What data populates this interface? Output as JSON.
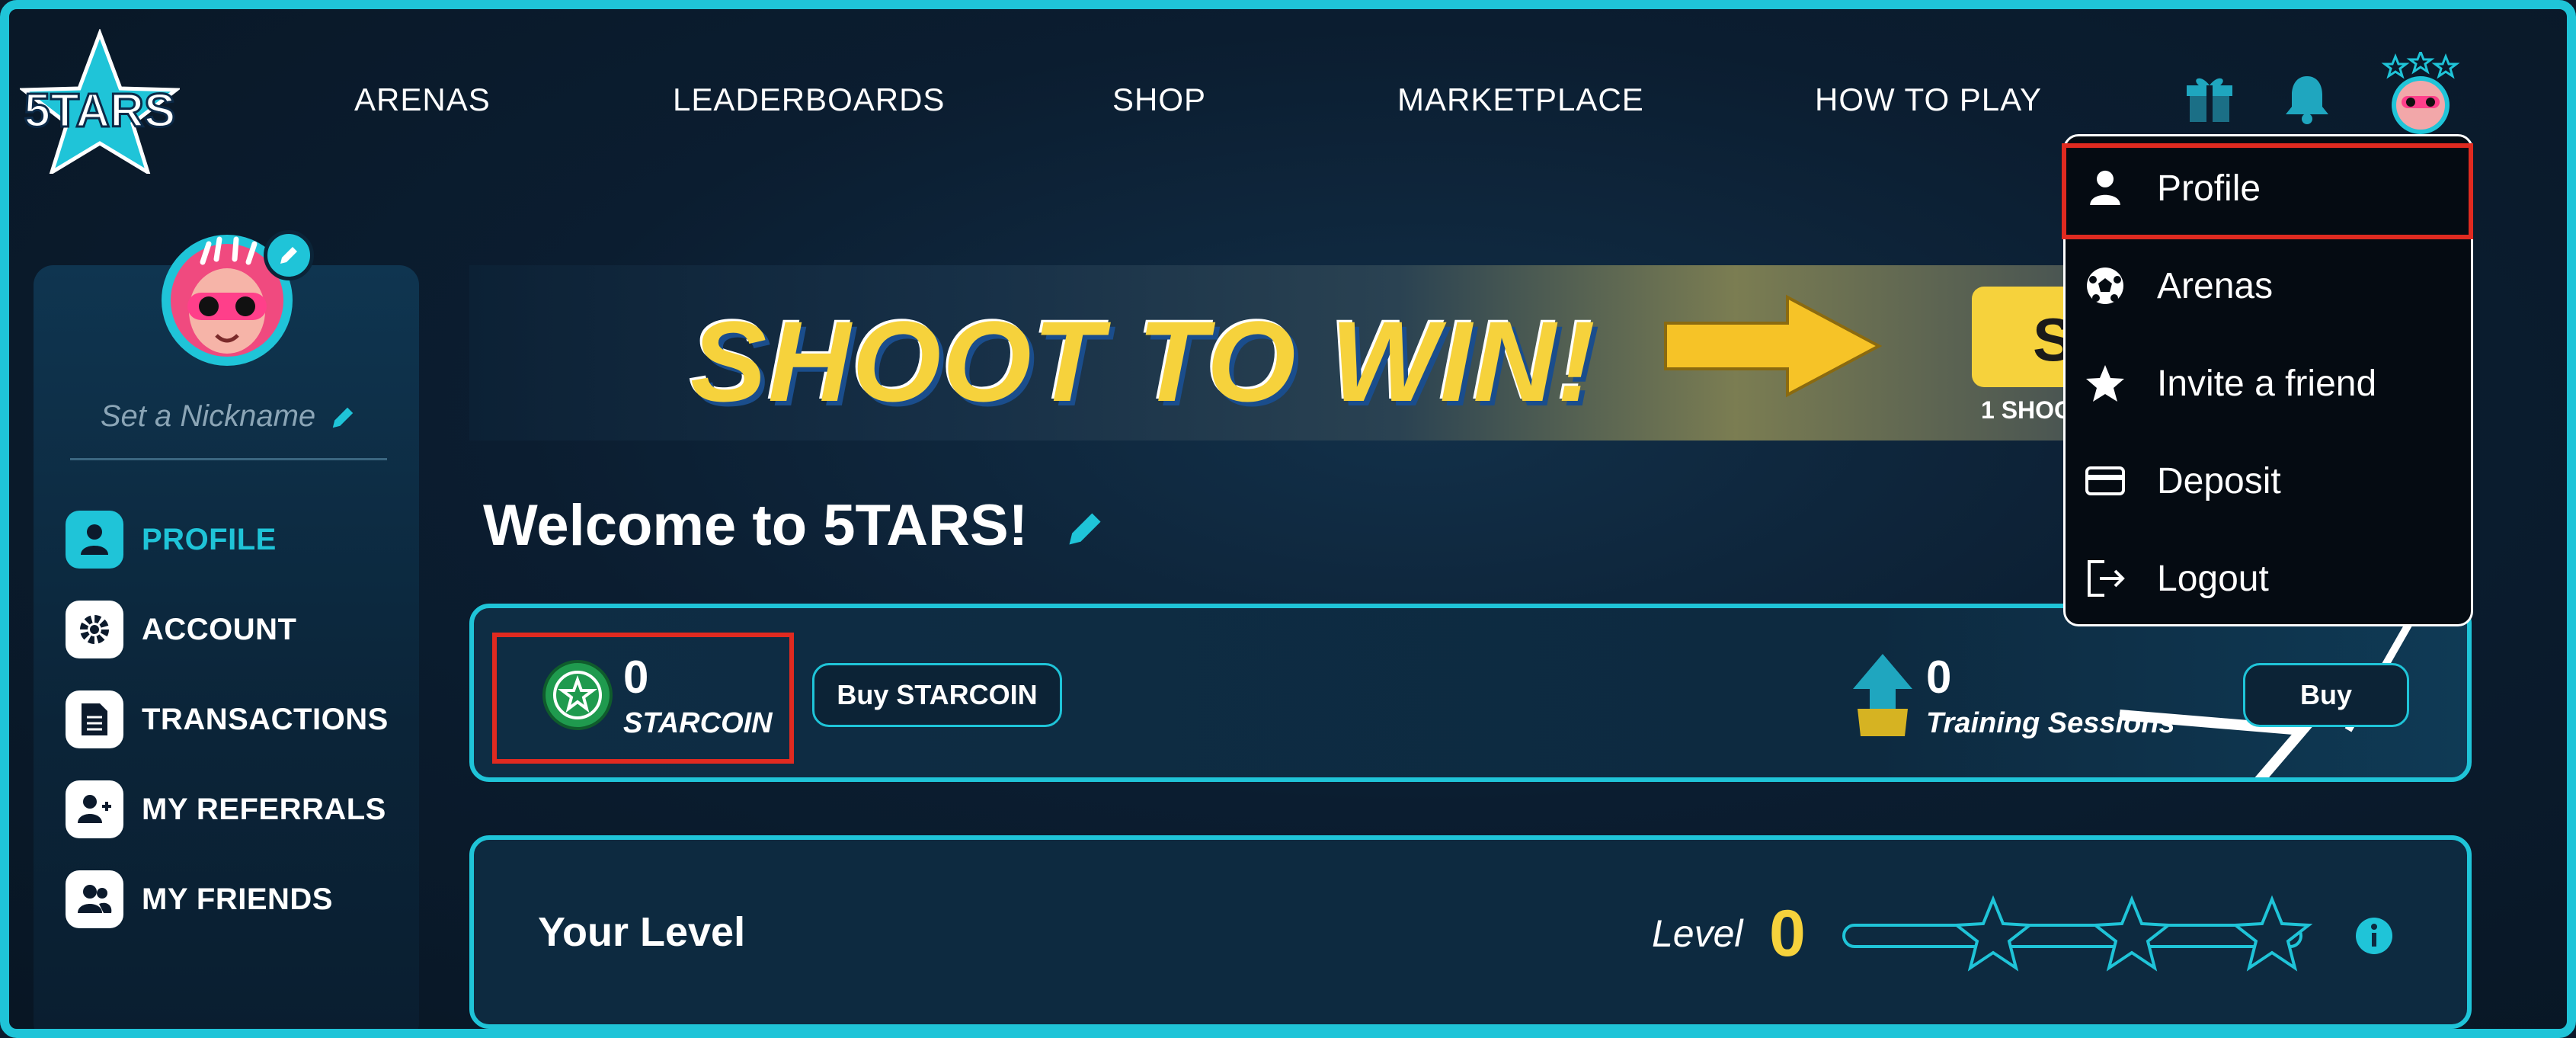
{
  "header": {
    "logo_text": "5TARS",
    "nav": [
      "ARENAS",
      "LEADERBOARDS",
      "SHOP",
      "MARKETPLACE",
      "HOW TO PLAY"
    ],
    "icons": [
      "gift-icon",
      "bell-icon",
      "avatar"
    ]
  },
  "sidebar": {
    "nickname_placeholder": "Set a Nickname",
    "items": [
      {
        "label": "PROFILE",
        "icon": "user-icon",
        "active": true
      },
      {
        "label": "ACCOUNT",
        "icon": "gear-icon",
        "active": false
      },
      {
        "label": "TRANSACTIONS",
        "icon": "document-icon",
        "active": false
      },
      {
        "label": "MY REFERRALS",
        "icon": "referrals-icon",
        "active": false
      },
      {
        "label": "MY FRIENDS",
        "icon": "friends-icon",
        "active": false
      }
    ]
  },
  "banner": {
    "title": "SHOOT TO WIN!",
    "cta_partial": "S",
    "subtitle_partial": "1 SHOO"
  },
  "welcome": {
    "title": "Welcome to 5TARS!"
  },
  "wallet": {
    "starcoin_amount": "0",
    "starcoin_unit": "STARCOIN",
    "buy_starcoin_label": "Buy STARCOIN",
    "training_amount": "0",
    "training_unit": "Training Sessions",
    "buy_label": "Buy"
  },
  "level": {
    "title": "Your Level",
    "label": "Level",
    "value": "0"
  },
  "dropdown": {
    "items": [
      {
        "label": "Profile",
        "icon": "user-icon",
        "highlighted": true
      },
      {
        "label": "Arenas",
        "icon": "soccer-ball-icon"
      },
      {
        "label": "Invite a friend",
        "icon": "star-icon"
      },
      {
        "label": "Deposit",
        "icon": "card-icon"
      },
      {
        "label": "Logout",
        "icon": "logout-icon"
      }
    ]
  },
  "colors": {
    "accent": "#1fc4d8",
    "highlight": "#e02a20",
    "gold": "#f6d23c",
    "background": "#0c1a2c"
  }
}
